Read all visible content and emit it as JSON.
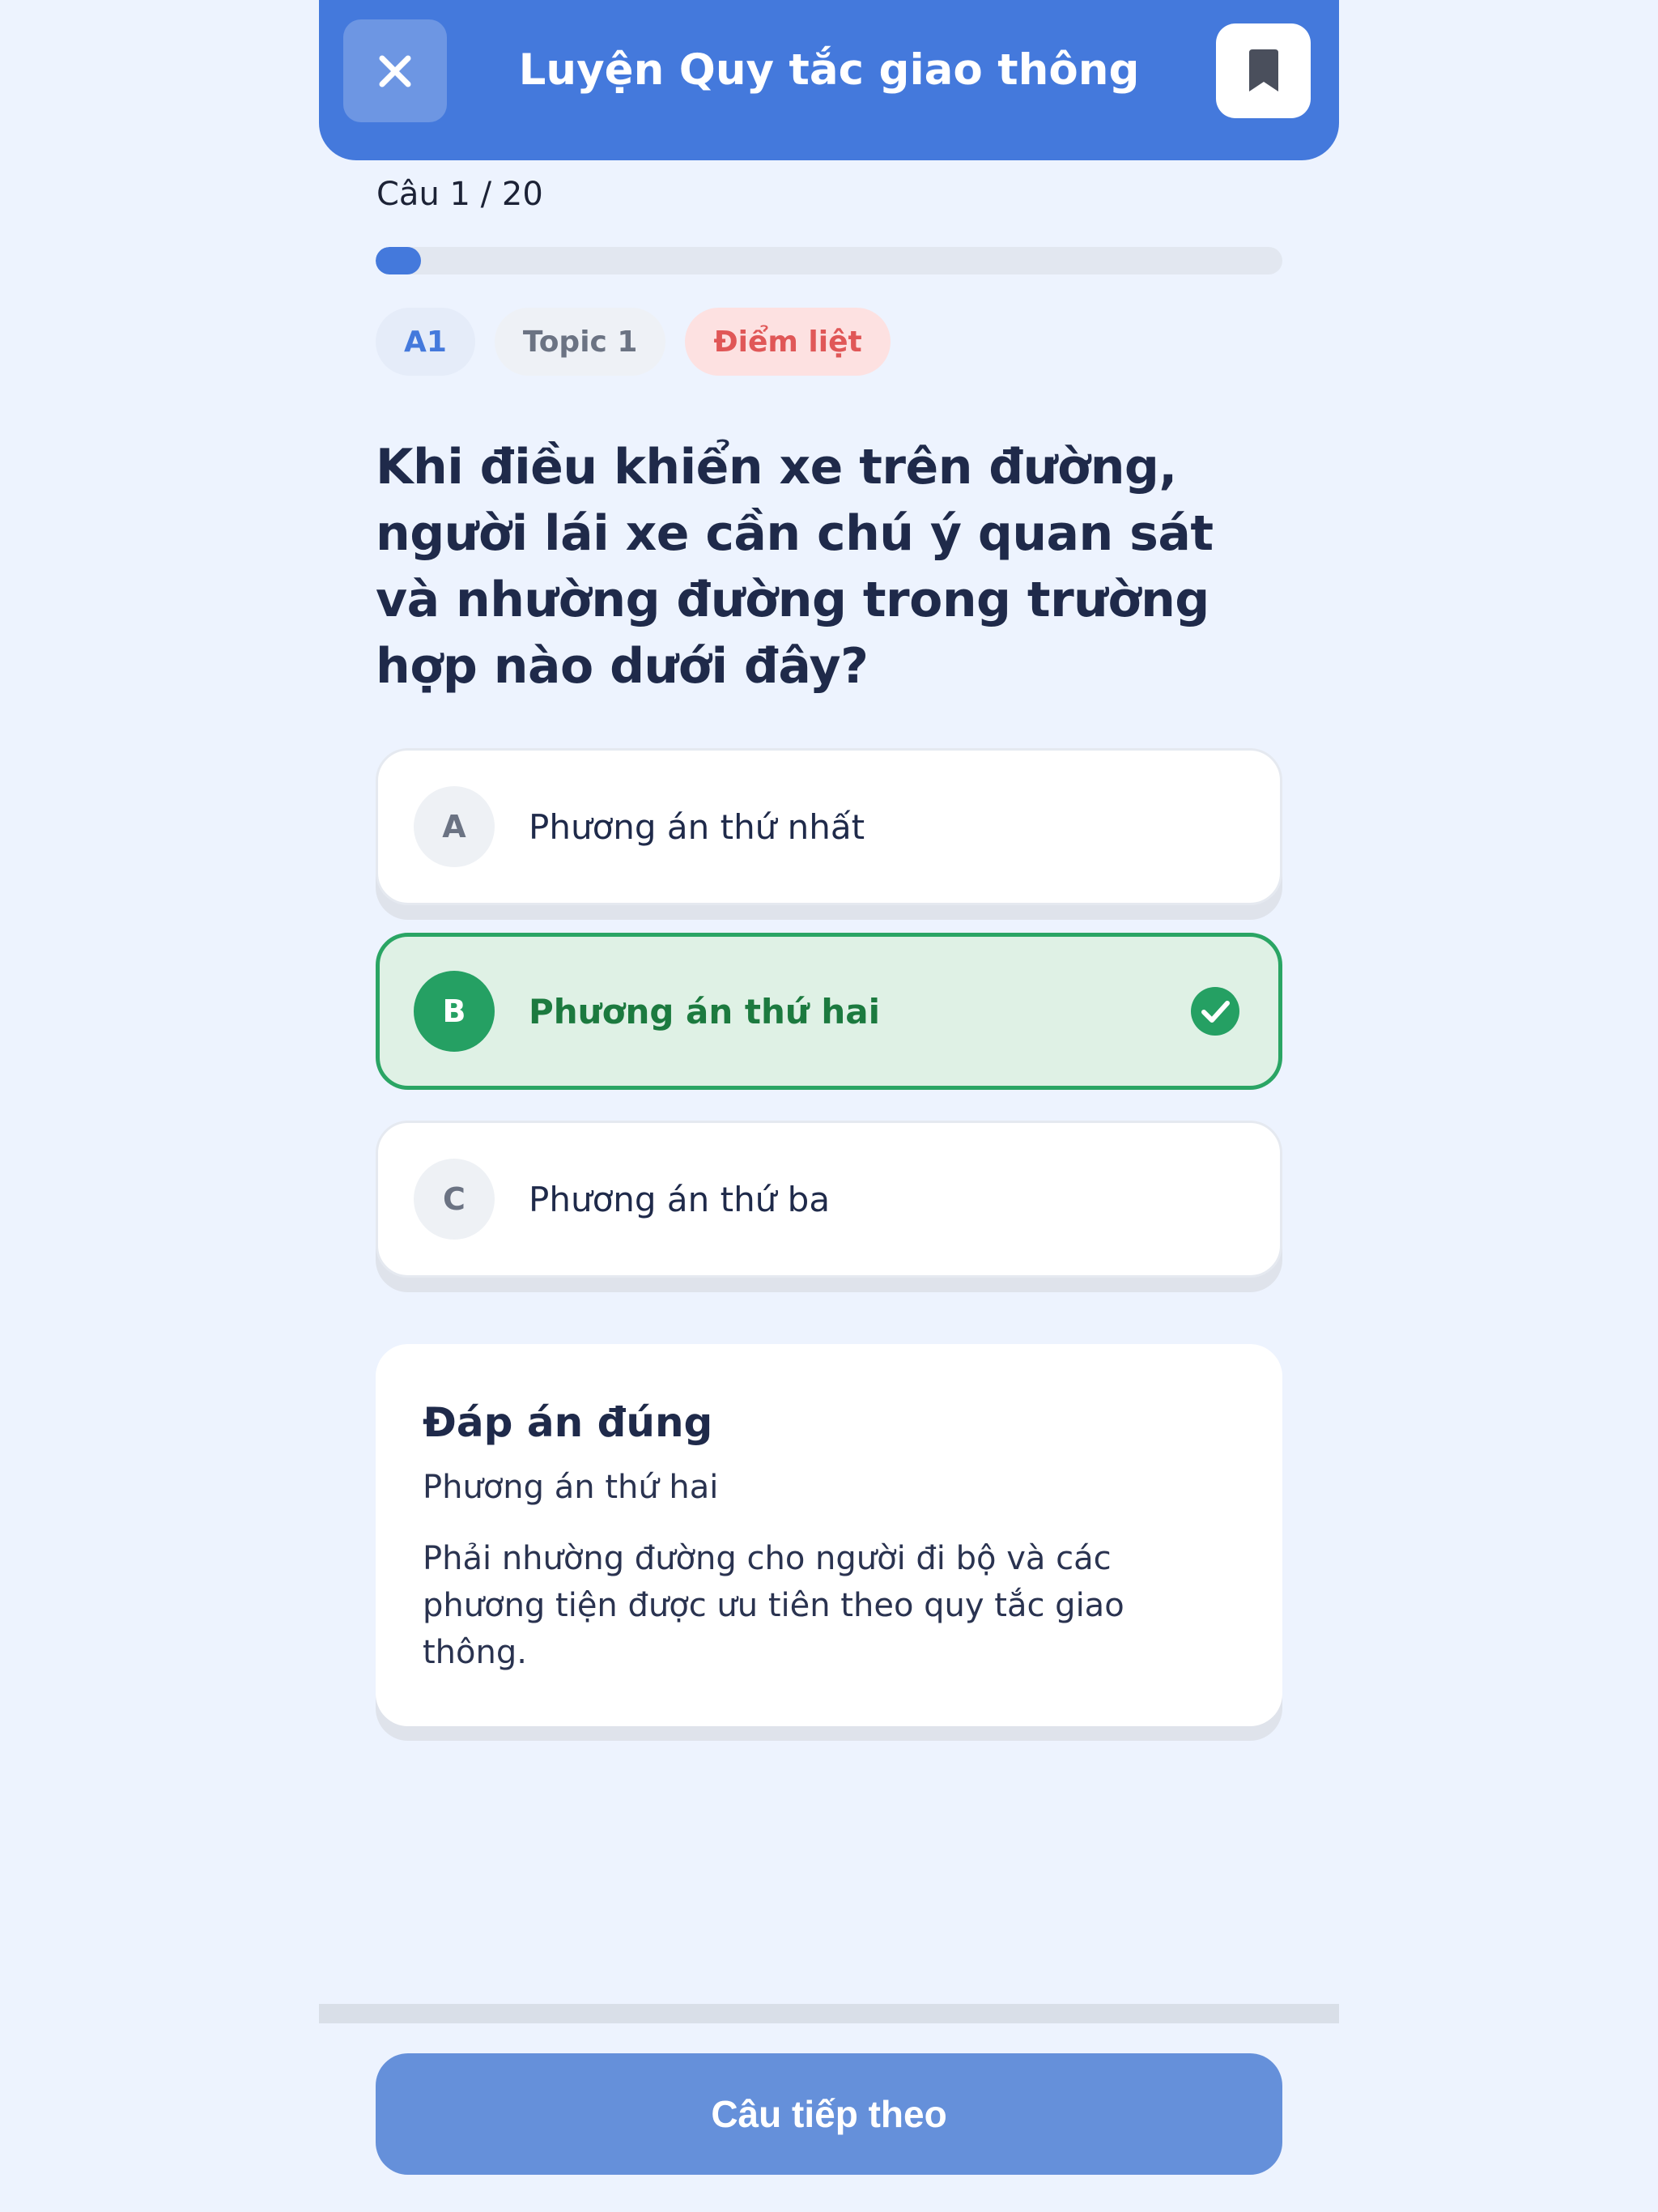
{
  "header": {
    "title": "Luyện Quy tắc giao thông",
    "close_icon": "close-icon",
    "bookmark_icon": "bookmark-icon"
  },
  "progress": {
    "counter_label": "Câu 1 / 20",
    "current": 1,
    "total": 20,
    "fraction": 0.05
  },
  "tags": {
    "level": "A1",
    "topic": "Topic 1",
    "critical": "Điểm liệt"
  },
  "question": {
    "text": "Khi điều khiển xe trên đường, người lái xe cần chú ý quan sát và nhường đường trong trường hợp nào dưới đây?"
  },
  "options": [
    {
      "letter": "A",
      "text": "Phương án thứ nhất",
      "selected": false
    },
    {
      "letter": "B",
      "text": "Phương án thứ hai",
      "selected": true,
      "icon": "check-circle-icon"
    },
    {
      "letter": "C",
      "text": "Phương án thứ ba",
      "selected": false
    }
  ],
  "answer": {
    "heading": "Đáp án đúng",
    "choice": "Phương án thứ hai",
    "explanation": "Phải nhường đường cho người đi bộ và các phương tiện được ưu tiên theo quy tắc giao thông."
  },
  "footer": {
    "next_label": "Câu tiếp theo"
  },
  "colors": {
    "primary": "#4479dc",
    "success": "#25a063",
    "danger": "#e05757",
    "background": "#edf3fe"
  }
}
